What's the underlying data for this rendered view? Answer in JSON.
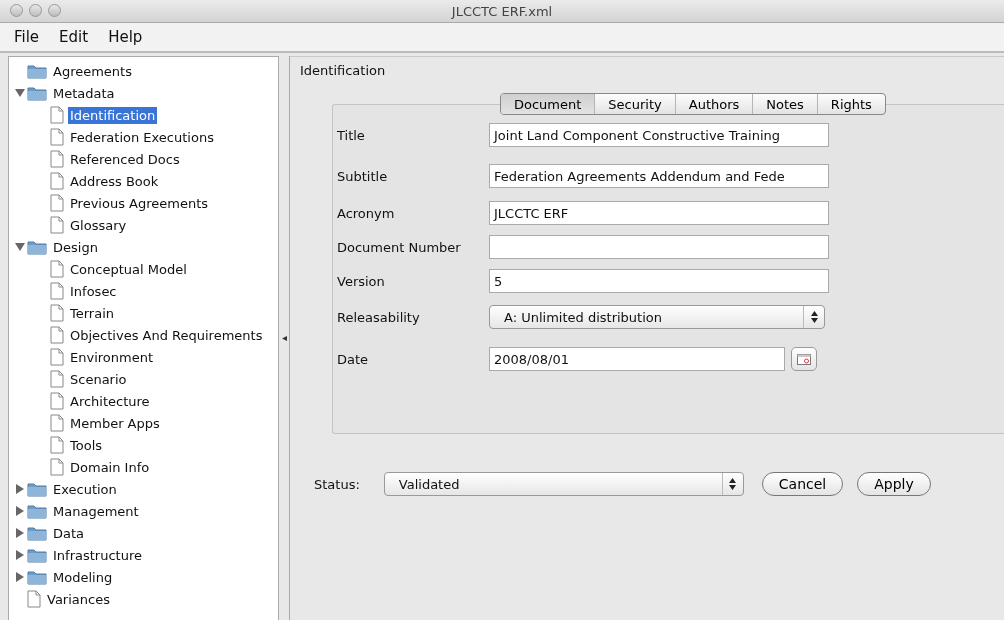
{
  "window": {
    "title": "JLCCTC ERF.xml"
  },
  "menu": [
    "File",
    "Edit",
    "Help"
  ],
  "tree": [
    {
      "label": "Agreements",
      "kind": "folder",
      "selected": false
    },
    {
      "label": "Metadata",
      "kind": "folder",
      "expanded": true,
      "selected": false,
      "children": [
        {
          "label": "Identification",
          "kind": "doc",
          "selected": true
        },
        {
          "label": "Federation Executions",
          "kind": "doc",
          "selected": false
        },
        {
          "label": "Referenced Docs",
          "kind": "doc",
          "selected": false
        },
        {
          "label": "Address Book",
          "kind": "doc",
          "selected": false
        },
        {
          "label": "Previous Agreements",
          "kind": "doc",
          "selected": false
        },
        {
          "label": "Glossary",
          "kind": "doc",
          "selected": false
        }
      ]
    },
    {
      "label": "Design",
      "kind": "folder",
      "expanded": true,
      "selected": false,
      "children": [
        {
          "label": "Conceptual Model",
          "kind": "doc",
          "selected": false
        },
        {
          "label": "Infosec",
          "kind": "doc",
          "selected": false
        },
        {
          "label": "Terrain",
          "kind": "doc",
          "selected": false
        },
        {
          "label": "Objectives And Requirements",
          "kind": "doc",
          "selected": false
        },
        {
          "label": "Environment",
          "kind": "doc",
          "selected": false
        },
        {
          "label": "Scenario",
          "kind": "doc",
          "selected": false
        },
        {
          "label": "Architecture",
          "kind": "doc",
          "selected": false
        },
        {
          "label": "Member Apps",
          "kind": "doc",
          "selected": false
        },
        {
          "label": "Tools",
          "kind": "doc",
          "selected": false
        },
        {
          "label": "Domain Info",
          "kind": "doc",
          "selected": false
        }
      ]
    },
    {
      "label": "Execution",
      "kind": "folder",
      "expanded": false,
      "selected": false
    },
    {
      "label": "Management",
      "kind": "folder",
      "expanded": false,
      "selected": false
    },
    {
      "label": "Data",
      "kind": "folder",
      "expanded": false,
      "selected": false
    },
    {
      "label": "Infrastructure",
      "kind": "folder",
      "expanded": false,
      "selected": false
    },
    {
      "label": "Modeling",
      "kind": "folder",
      "expanded": false,
      "selected": false
    },
    {
      "label": "Variances",
      "kind": "doc",
      "selected": false
    }
  ],
  "panel": {
    "heading": "Identification",
    "tabs": [
      {
        "label": "Document",
        "selected": true
      },
      {
        "label": "Security",
        "selected": false
      },
      {
        "label": "Authors",
        "selected": false
      },
      {
        "label": "Notes",
        "selected": false
      },
      {
        "label": "Rights",
        "selected": false
      }
    ],
    "fields": [
      {
        "label": "Title",
        "kind": "text",
        "value": "Joint Land Component Constructive Training"
      },
      {
        "label": "Subtitle",
        "kind": "text",
        "value": "Federation Agreements Addendum  and  Fede"
      },
      {
        "label": "Acronym",
        "kind": "text",
        "value": "JLCCTC ERF"
      },
      {
        "label": "Document Number",
        "kind": "text"
      },
      {
        "label": "Version",
        "kind": "text",
        "value": "5"
      },
      {
        "label": "Releasability",
        "kind": "select",
        "value": "A: Unlimited distribution"
      },
      {
        "label": "Date",
        "kind": "date",
        "value": "2008/08/01"
      }
    ],
    "status": {
      "label": "Status:",
      "value": "Validated"
    },
    "buttons": [
      "Cancel",
      "Apply"
    ]
  }
}
